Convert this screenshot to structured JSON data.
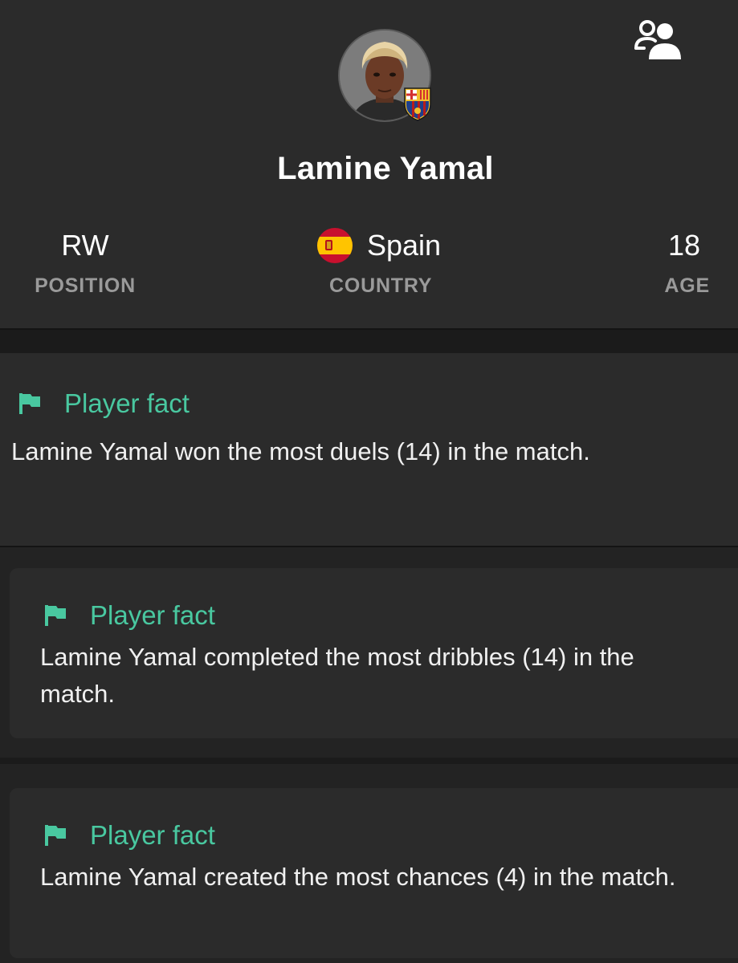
{
  "player": {
    "name": "Lamine Yamal",
    "position_value": "RW",
    "position_label": "POSITION",
    "country_value": "Spain",
    "country_label": "COUNTRY",
    "age_value": "18",
    "age_label": "AGE"
  },
  "icons": {
    "players": "players-icon",
    "fact_flag": "flag-icon",
    "country_flag": "spain-flag-icon",
    "club_badge": "fc-barcelona-badge-icon"
  },
  "colors": {
    "accent": "#49c8a0",
    "card": "#2b2b2b",
    "background": "#1b1b1b",
    "muted_text": "#9a9a9a"
  },
  "facts": [
    {
      "title": "Player fact",
      "text": "Lamine Yamal won the most duels (14) in the match."
    },
    {
      "title": "Player fact",
      "text": "Lamine Yamal completed the most dribbles (14) in the match."
    },
    {
      "title": "Player fact",
      "text": "Lamine Yamal created the most chances (4) in the match."
    }
  ]
}
